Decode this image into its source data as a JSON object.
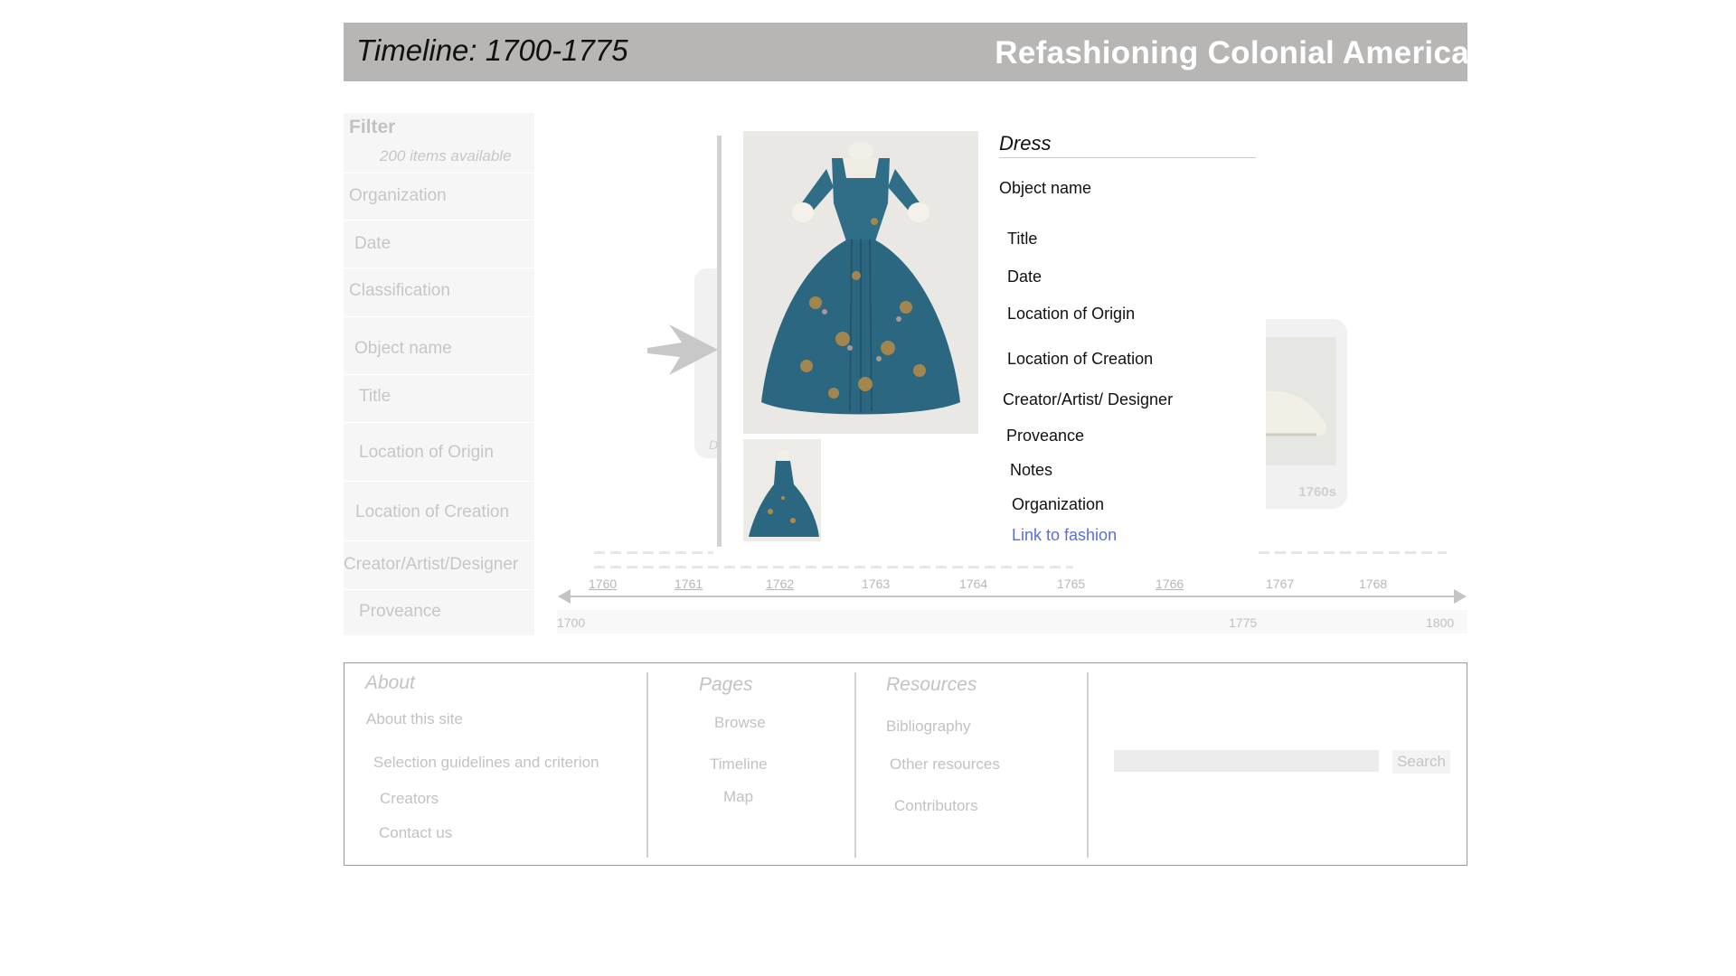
{
  "header": {
    "timeline_label": "Timeline: 1700-1775",
    "site_title": "Refashioning Colonial America"
  },
  "filter": {
    "title": "Filter",
    "count": "200 items available",
    "items": [
      "Organization",
      "Date",
      "Classification",
      "Object name",
      "Title",
      "Location of Origin",
      "Location of Creation",
      "Creator/Artist/Designer",
      "Proveance"
    ]
  },
  "carousel": {
    "left_card_text": "D",
    "right_card_label": "1760s"
  },
  "detail": {
    "title": "Dress",
    "fields": [
      "Object name",
      "Title",
      "Date",
      "Location of Origin",
      "Location of Creation",
      "Creator/Artist/ Designer",
      "Proveance",
      "Notes",
      "Organization"
    ],
    "link": "Link to fashion"
  },
  "timeline": {
    "years": [
      {
        "label": "1760",
        "linked": true
      },
      {
        "label": "1761",
        "linked": true
      },
      {
        "label": "1762",
        "linked": true
      },
      {
        "label": "1763",
        "linked": false
      },
      {
        "label": "1764",
        "linked": false
      },
      {
        "label": "1765",
        "linked": false
      },
      {
        "label": "1766",
        "linked": true
      },
      {
        "label": "1767",
        "linked": false
      },
      {
        "label": "1768",
        "linked": false
      }
    ],
    "range_start": "1700",
    "range_mid": "1775",
    "range_end": "1800"
  },
  "footer": {
    "about": {
      "heading": "About",
      "links": [
        "About this site",
        "Selection guidelines and criterion",
        "Creators",
        "Contact us"
      ]
    },
    "pages": {
      "heading": "Pages",
      "links": [
        "Browse",
        "Timeline",
        "Map"
      ]
    },
    "resources": {
      "heading": "Resources",
      "links": [
        "Bibliography",
        "Other resources",
        "Contributors"
      ]
    },
    "search": {
      "value": "",
      "button": "Search"
    }
  },
  "colors": {
    "header_bg": "#b8b6b4",
    "header_title": "#ffffff",
    "link": "#5a6fd6",
    "dress_teal": "#2f6e86"
  }
}
